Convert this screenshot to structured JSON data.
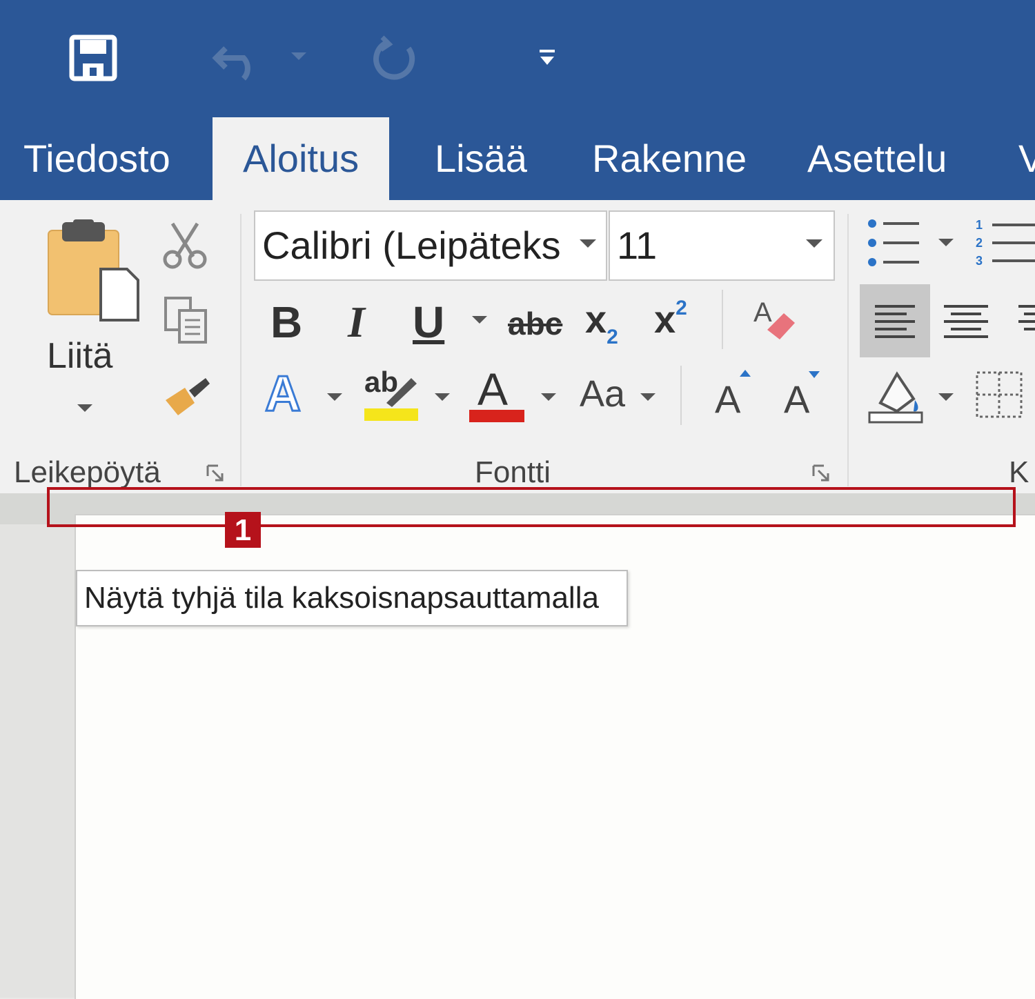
{
  "qat": {
    "save_icon": "save-icon",
    "undo_icon": "undo-icon",
    "redo_icon": "redo-icon",
    "customize_icon": "customize-qat-icon"
  },
  "tabs": [
    {
      "label": "Tiedosto"
    },
    {
      "label": "Aloitus",
      "active": true
    },
    {
      "label": "Lisää"
    },
    {
      "label": "Rakenne"
    },
    {
      "label": "Asettelu"
    },
    {
      "label": "V"
    }
  ],
  "clipboard": {
    "paste_label": "Liitä",
    "group_label": "Leikepöytä"
  },
  "font": {
    "font_name": "Calibri (Leipäteks",
    "font_size": "11",
    "bold": "B",
    "italic": "I",
    "underline": "U",
    "strike": "abc",
    "subscript_base": "x",
    "subscript_mark": "2",
    "superscript_base": "x",
    "superscript_mark": "2",
    "case": "Aa",
    "grow": "A",
    "shrink": "A",
    "text_effects": "A",
    "highlight": "ab",
    "font_color": "A",
    "group_label": "Fontti"
  },
  "paragraph": {
    "group_label_partial": "K"
  },
  "callout": {
    "badge": "1"
  },
  "tooltip": {
    "text": "Näytä tyhjä tila kaksoisnapsauttamalla"
  },
  "colors": {
    "accent": "#2b5797",
    "highlight_yellow": "#f5e51b",
    "font_red": "#d8231c",
    "callout_red": "#b5121b"
  }
}
